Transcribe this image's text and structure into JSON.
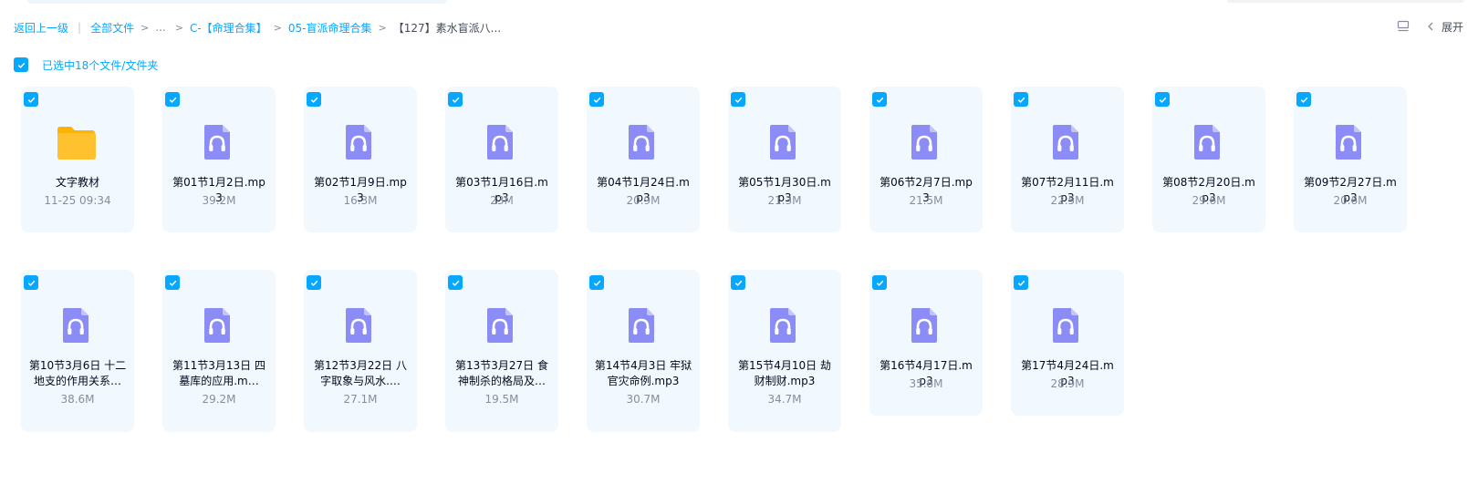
{
  "breadcrumb": {
    "back": "返回上一级",
    "root": "全部文件",
    "ellipsis": "...",
    "level1": "C-【命理合集】",
    "level2": "05-盲派命理合集",
    "current": "【127】素水盲派八..."
  },
  "toolbar": {
    "expand_label": "展开"
  },
  "selection": {
    "text": "已选中18个文件/文件夹"
  },
  "colors": {
    "accent": "#06a7ff",
    "tile_bg": "#f2f9fe",
    "audio_icon": "#8b8cf6",
    "folder_icon": "#ffc12e"
  },
  "files": [
    {
      "name": "文字教材",
      "meta": "11-25 09:34",
      "type": "folder"
    },
    {
      "name": "第01节1月2日.mp3",
      "meta": "39.2M",
      "type": "audio"
    },
    {
      "name": "第02节1月9日.mp3",
      "meta": "16.3M",
      "type": "audio"
    },
    {
      "name": "第03节1月16日.mp3",
      "meta": "23M",
      "type": "audio"
    },
    {
      "name": "第04节1月24日.mp3",
      "meta": "20.9M",
      "type": "audio"
    },
    {
      "name": "第05节1月30日.mp3",
      "meta": "21.3M",
      "type": "audio"
    },
    {
      "name": "第06节2月7日.mp3",
      "meta": "21.5M",
      "type": "audio"
    },
    {
      "name": "第07节2月11日.mp3",
      "meta": "22.5M",
      "type": "audio"
    },
    {
      "name": "第08节2月20日.mp3",
      "meta": "29.6M",
      "type": "audio"
    },
    {
      "name": "第09节2月27日.mp3",
      "meta": "20.6M",
      "type": "audio"
    },
    {
      "name": "第10节3月6日 十二地支的作用关系…",
      "meta": "38.6M",
      "type": "audio"
    },
    {
      "name": "第11节3月13日 四墓库的应用.m…",
      "meta": "29.2M",
      "type": "audio"
    },
    {
      "name": "第12节3月22日 八字取象与风水.…",
      "meta": "27.1M",
      "type": "audio"
    },
    {
      "name": "第13节3月27日 食神制杀的格局及…",
      "meta": "19.5M",
      "type": "audio"
    },
    {
      "name": "第14节4月3日 牢狱官灾命例.mp3",
      "meta": "30.7M",
      "type": "audio"
    },
    {
      "name": "第15节4月10日 劫财制财.mp3",
      "meta": "34.7M",
      "type": "audio"
    },
    {
      "name": "第16节4月17日.mp3",
      "meta": "35.8M",
      "type": "audio"
    },
    {
      "name": "第17节4月24日.mp3",
      "meta": "28.9M",
      "type": "audio"
    }
  ]
}
